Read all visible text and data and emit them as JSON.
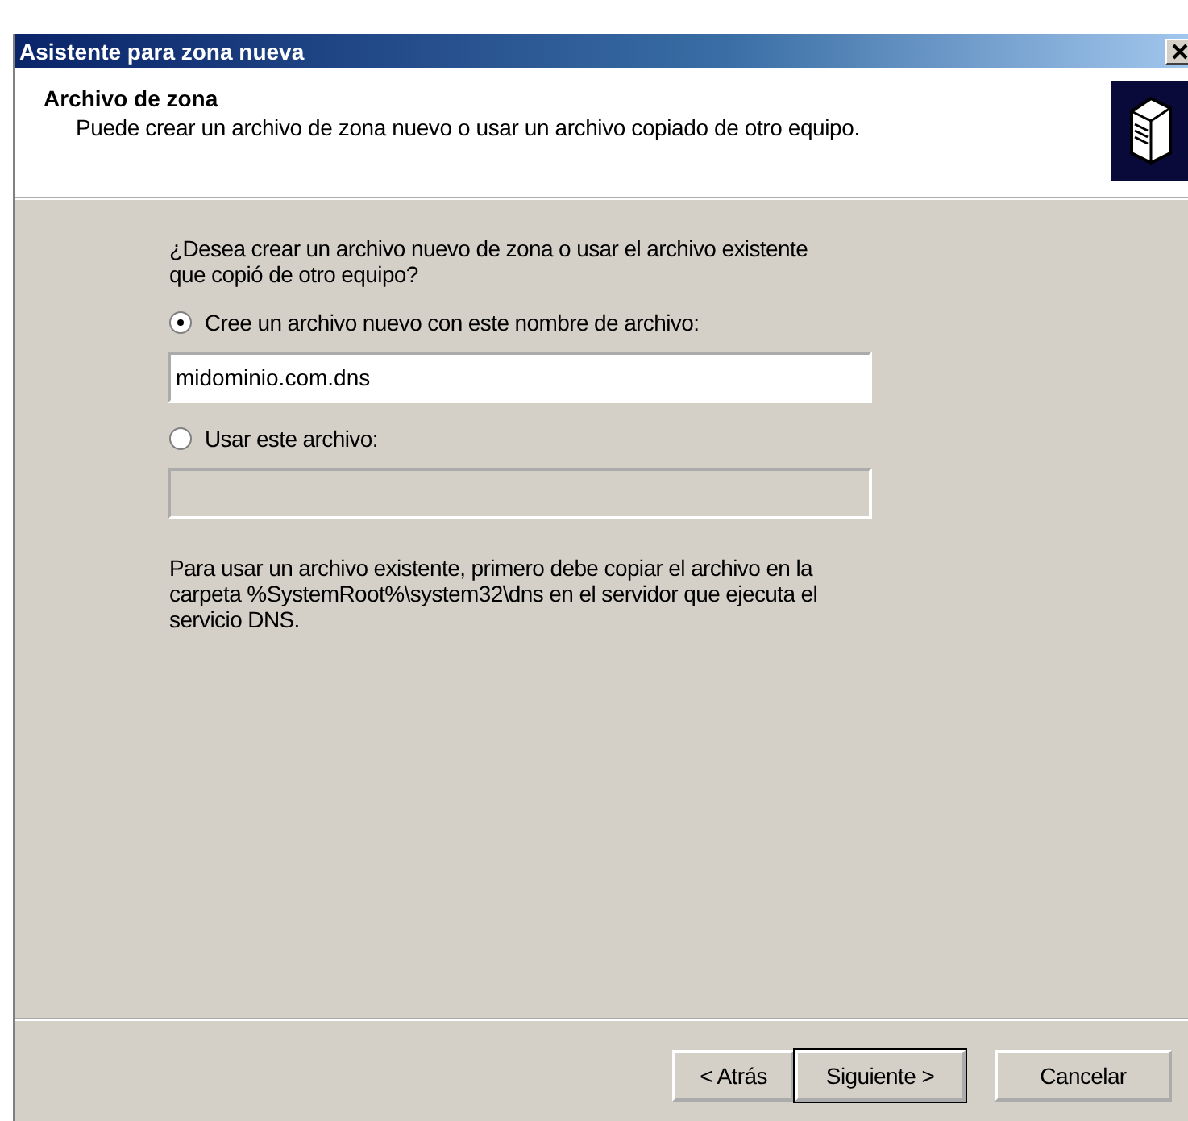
{
  "window": {
    "title": "Asistente para zona nueva"
  },
  "header": {
    "title": "Archivo de zona",
    "subtitle": "Puede crear un archivo de zona nuevo o usar un archivo copiado de otro equipo."
  },
  "question": "¿Desea crear un archivo nuevo de zona o usar el archivo existente que copió de otro equipo?",
  "options": [
    {
      "label": "Cree un archivo nuevo con este nombre de archivo:",
      "selected": true,
      "field": {
        "value": "midominio.com.dns",
        "disabled": false
      }
    },
    {
      "label": "Usar este archivo:",
      "selected": false,
      "field": {
        "disabled": true
      }
    }
  ],
  "note": "Para usar un archivo existente, primero debe copiar el archivo en la carpeta %SystemRoot%\\system32\\dns en el servidor que ejecuta el servicio DNS.",
  "buttons": [
    {
      "label": "< Atrás",
      "default": false
    },
    {
      "label": "Siguiente >",
      "default": true
    },
    {
      "label": "Cancelar",
      "default": false
    }
  ]
}
